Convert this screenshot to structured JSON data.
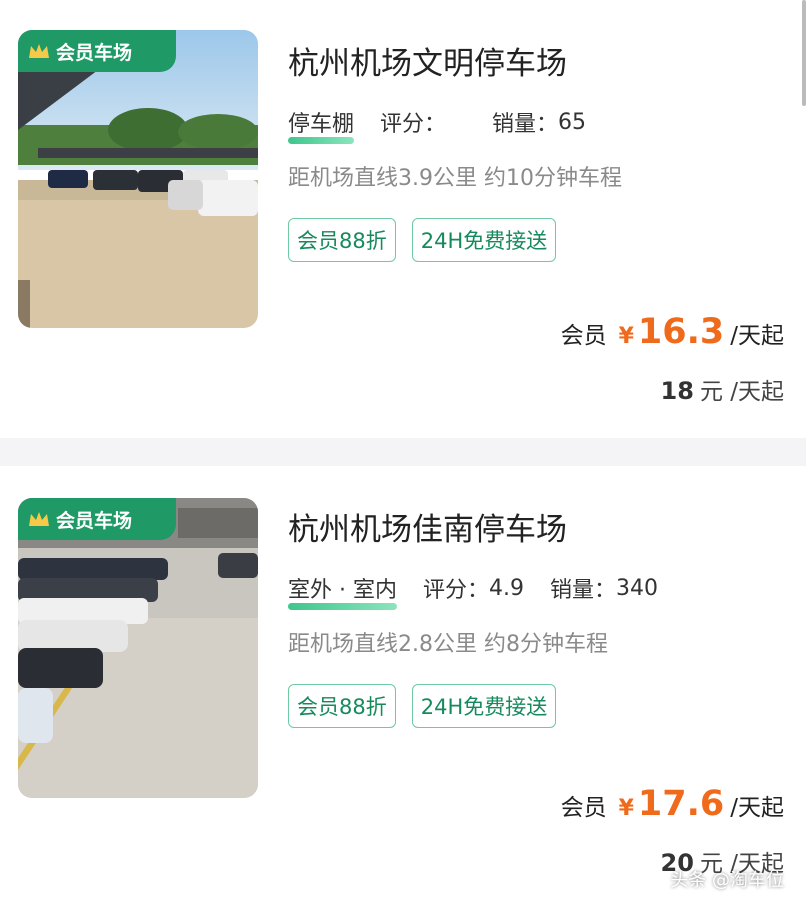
{
  "listings": [
    {
      "badge": "会员车场",
      "title": "杭州机场文明停车场",
      "type": "停车棚",
      "rating_label": "评分：",
      "rating": "",
      "sales_label": "销量：",
      "sales": "65",
      "distance": "距机场直线3.9公里 约10分钟车程",
      "tags": [
        "会员88折",
        "24H免费接送"
      ],
      "member_label": "会员",
      "currency": "¥",
      "member_price": "16.3",
      "price_unit": "/天起",
      "original_price": "18",
      "original_unit": "元 /天起"
    },
    {
      "badge": "会员车场",
      "title": "杭州机场佳南停车场",
      "type": "室外 · 室内",
      "rating_label": "评分：",
      "rating": "4.9",
      "sales_label": "销量：",
      "sales": "340",
      "distance": "距机场直线2.8公里 约8分钟车程",
      "tags": [
        "会员88折",
        "24H免费接送"
      ],
      "member_label": "会员",
      "currency": "¥",
      "member_price": "17.6",
      "price_unit": "/天起",
      "original_price": "20",
      "original_unit": "元 /天起"
    }
  ],
  "watermark": "头条 @淘车位",
  "colors": {
    "brand_green": "#1f9a66",
    "price_orange": "#f06a1c",
    "tag_border": "#6fc9a4"
  }
}
